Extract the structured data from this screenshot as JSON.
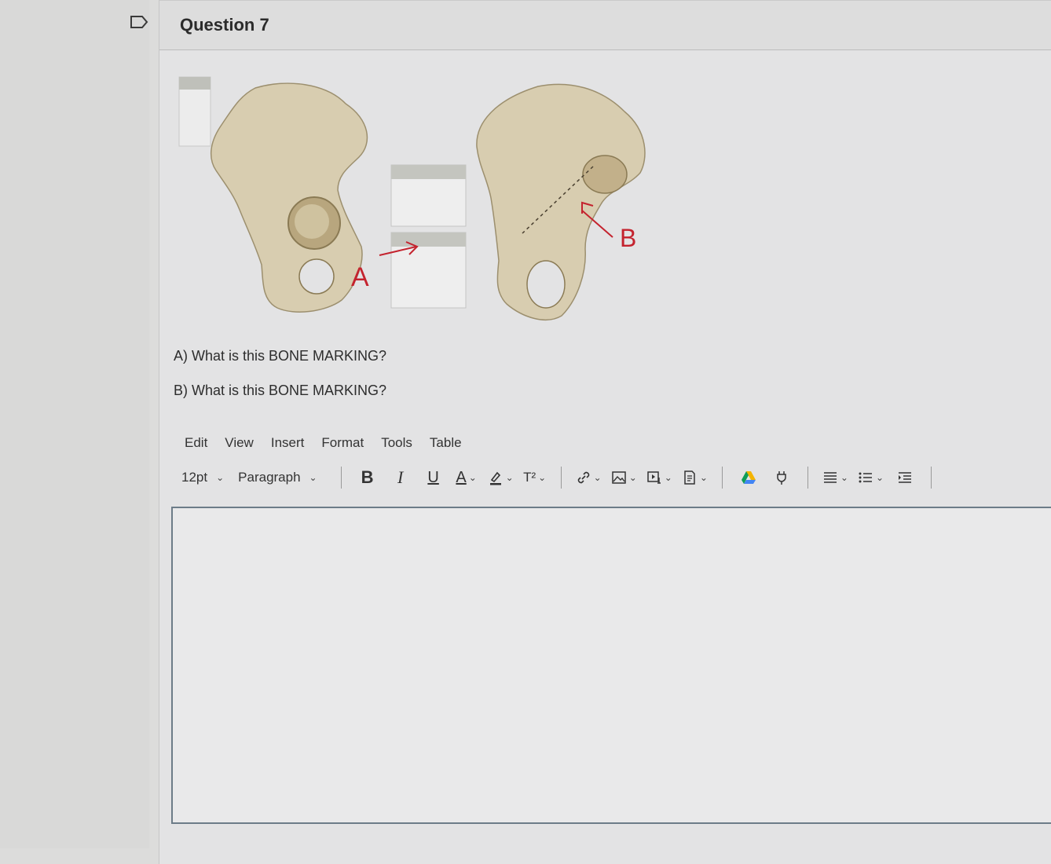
{
  "question": {
    "title": "Question 7",
    "figure": {
      "label_a": "A",
      "label_b": "B"
    },
    "prompt_a": "A) What is this BONE MARKING?",
    "prompt_b": "B) What is this BONE MARKING?"
  },
  "editor": {
    "menu": [
      "Edit",
      "View",
      "Insert",
      "Format",
      "Tools",
      "Table"
    ],
    "font_size": "12pt",
    "block_format": "Paragraph",
    "bold_label": "B",
    "italic_label": "I",
    "underline_label": "U",
    "text_color_label": "A",
    "superscript_label": "T²",
    "value": ""
  },
  "colors": {
    "annotation_red": "#c4232e",
    "editor_border": "#6d7c88"
  }
}
